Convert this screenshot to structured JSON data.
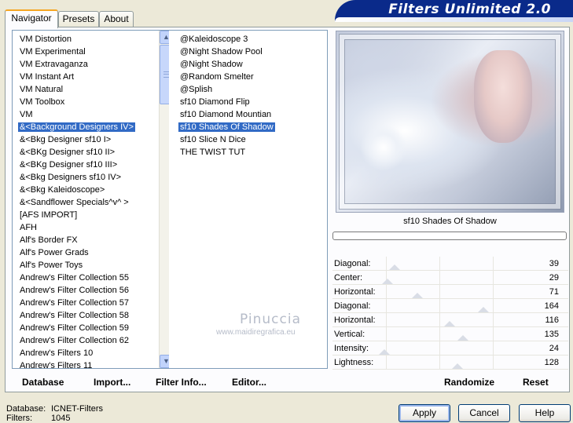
{
  "banner": {
    "title": "Filters Unlimited 2.0"
  },
  "tabs": [
    {
      "label": "Navigator",
      "active": true
    },
    {
      "label": "Presets",
      "active": false
    },
    {
      "label": "About",
      "active": false
    }
  ],
  "categories": [
    "VM Distortion",
    "VM Experimental",
    "VM Extravaganza",
    "VM Instant Art",
    "VM Natural",
    "VM Toolbox",
    "VM",
    "&<Background Designers IV>",
    "&<Bkg Designer sf10 I>",
    "&<BKg Designer sf10 II>",
    "&<BKg Designer sf10 III>",
    "&<Bkg Designers sf10 IV>",
    "&<Bkg Kaleidoscope>",
    "&<Sandflower Specials^v^ >",
    "[AFS IMPORT]",
    "AFH",
    "Alf's Border FX",
    "Alf's Power Grads",
    "Alf's Power Toys",
    "Andrew's Filter Collection 55",
    "Andrew's Filter Collection 56",
    "Andrew's Filter Collection 57",
    "Andrew's Filter Collection 58",
    "Andrew's Filter Collection 59",
    "Andrew's Filter Collection 62",
    "Andrew's Filters 10",
    "Andrew's Filters 11"
  ],
  "selected_category_index": 7,
  "filters": [
    "@Kaleidoscope 3",
    "@Night Shadow Pool",
    "@Night Shadow",
    "@Random Smelter",
    "@Splish",
    "sf10 Diamond Flip",
    "sf10 Diamond Mountian",
    "sf10 Shades Of Shadow",
    "sf10 Slice N Dice",
    "THE TWIST TUT"
  ],
  "selected_filter_index": 7,
  "preview": {
    "filter_name": "sf10 Shades Of Shadow"
  },
  "sliders": [
    {
      "label": "Diagonal:",
      "value": "39",
      "level": 39
    },
    {
      "label": "Center:",
      "value": "29",
      "level": 29
    },
    {
      "label": "Horizontal:",
      "value": "71",
      "level": 71
    },
    {
      "label": "Diagonal:",
      "value": "164",
      "level": 164
    },
    {
      "label": "Horizontal:",
      "value": "116",
      "level": 116
    },
    {
      "label": "Vertical:",
      "value": "135",
      "level": 135
    },
    {
      "label": "Intensity:",
      "value": "24",
      "level": 24
    },
    {
      "label": "Lightness:",
      "value": "128",
      "level": 128
    }
  ],
  "slider_max": 255,
  "panel_buttons": {
    "database": "Database",
    "import": "Import...",
    "filter_info": "Filter Info...",
    "editor": "Editor...",
    "randomize": "Randomize",
    "reset": "Reset"
  },
  "watermark": {
    "name": "Pinuccia",
    "url": "www.maidiregrafica.eu"
  },
  "footer": {
    "database_label": "Database:",
    "database_value": "ICNET-Filters",
    "filters_label": "Filters:",
    "filters_value": "1045"
  },
  "dialog_buttons": {
    "apply": "Apply",
    "cancel": "Cancel",
    "help": "Help"
  },
  "colors": {
    "selection": "#316ac5",
    "banner": "#0a2a8a",
    "tab_highlight": "#f5a623"
  }
}
